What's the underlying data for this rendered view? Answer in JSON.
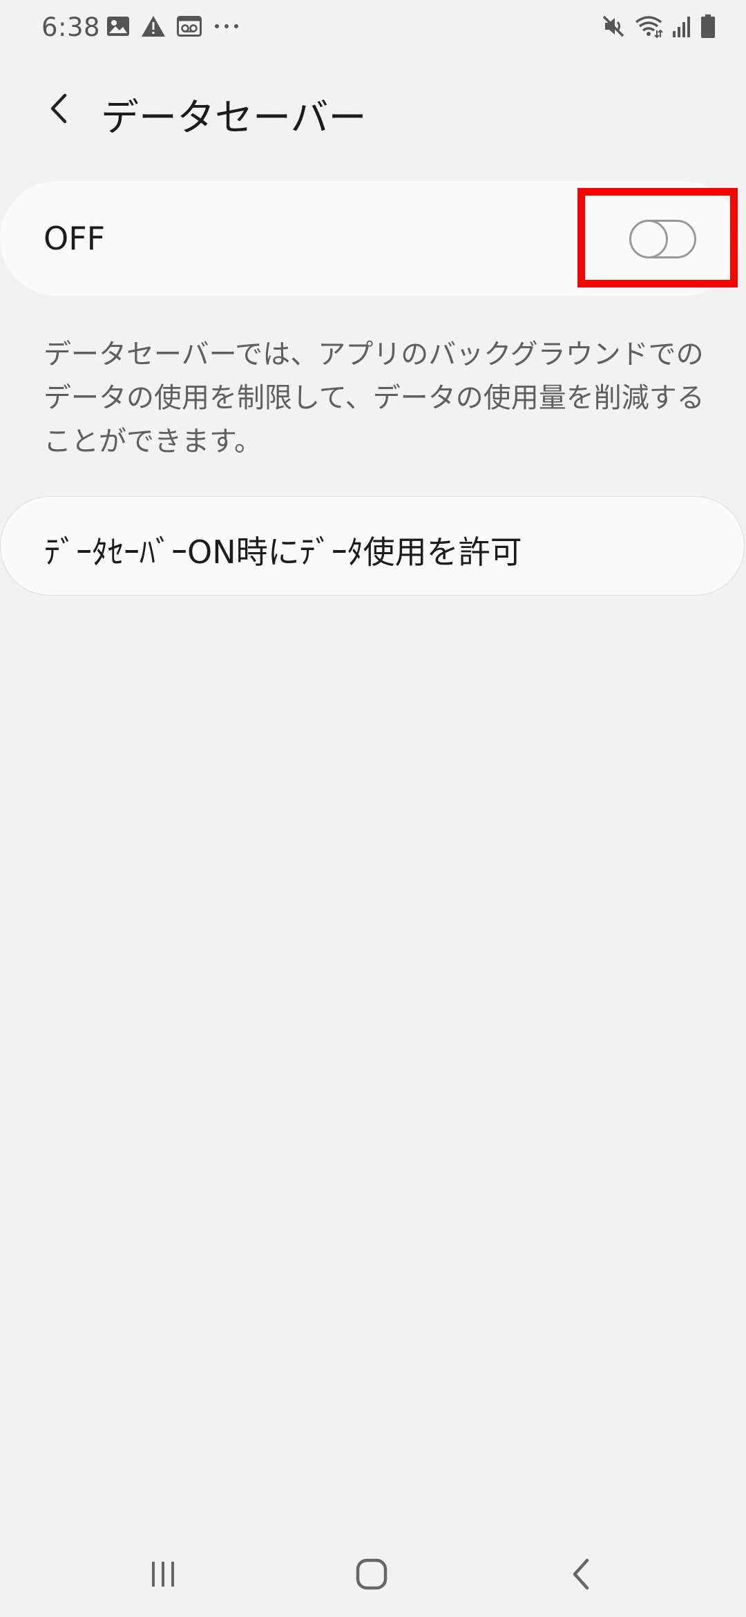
{
  "status_bar": {
    "time": "6:38",
    "left_icons": [
      "image-icon",
      "warning-icon",
      "voicemail-icon",
      "more-dots-icon"
    ],
    "right_icons": [
      "mute-icon",
      "wifi-icon",
      "signal-icon",
      "battery-icon"
    ]
  },
  "header": {
    "title": "データセーバー",
    "back_icon": "chevron-left-icon"
  },
  "master_switch": {
    "label": "OFF",
    "state": "off"
  },
  "description": {
    "text": "データセーバーでは、アプリのバックグラウンドでのデータの使用を制限して、データの使用量を削減することができます。"
  },
  "unrestricted_data": {
    "label": "ﾃﾞｰﾀｾｰﾊﾞｰON時にﾃﾞｰﾀ使用を許可"
  },
  "nav_bar": {
    "buttons": [
      "recents-icon",
      "home-icon",
      "back-icon"
    ]
  },
  "colors": {
    "background": "#f2f2f2",
    "card": "#fafafa",
    "highlight": "#ff0000",
    "toggle_border": "#999999"
  }
}
